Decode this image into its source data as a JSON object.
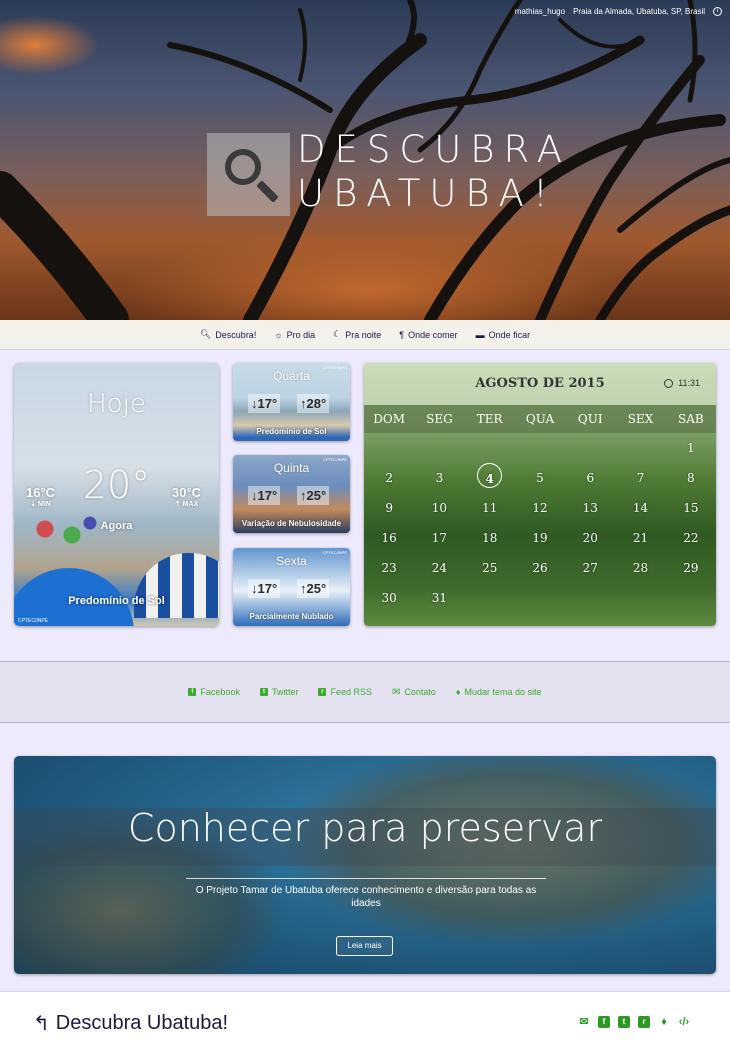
{
  "hero": {
    "credit_user": "mathias_hugo",
    "credit_location": "Praia da Almada, Ubatuba, SP, Brasil",
    "title_line1": "DESCUBRA",
    "title_line2": "UBATUBA!"
  },
  "nav": {
    "items": [
      {
        "icon": "search-icon",
        "label": "Descubra!"
      },
      {
        "icon": "sun-icon",
        "label": "Pro dia"
      },
      {
        "icon": "moon-icon",
        "label": "Pra noite"
      },
      {
        "icon": "cutlery-icon",
        "label": "Onde comer"
      },
      {
        "icon": "bed-icon",
        "label": "Onde ficar"
      }
    ]
  },
  "weather": {
    "today": {
      "label": "Hoje",
      "temp": "20°",
      "min": "16°C",
      "min_label": "MIN",
      "max": "30°C",
      "max_label": "MAX",
      "now_label": "Agora",
      "condition": "Predomínio de Sol",
      "source": "CPTEC/INPE"
    },
    "forecast": [
      {
        "day": "Quarta",
        "low": "↓17°",
        "high": "↑28°",
        "desc": "Predomínio de Sol",
        "source": "CPTEC/INPE"
      },
      {
        "day": "Quinta",
        "low": "↓17°",
        "high": "↑25°",
        "desc": "Variação de Nebulosidade",
        "source": "CPTEC/INPE"
      },
      {
        "day": "Sexta",
        "low": "↓17°",
        "high": "↑25°",
        "desc": "Parcialmente Nublado",
        "source": "CPTEC/INPE"
      }
    ]
  },
  "calendar": {
    "month": "AGOSTO DE 2015",
    "time": "11:31",
    "weekdays": [
      "DOM",
      "SEG",
      "TER",
      "QUA",
      "QUI",
      "SEX",
      "SAB"
    ],
    "weeks": [
      [
        "",
        "",
        "",
        "",
        "",
        "",
        "1"
      ],
      [
        "2",
        "3",
        "4",
        "5",
        "6",
        "7",
        "8"
      ],
      [
        "9",
        "10",
        "11",
        "12",
        "13",
        "14",
        "15"
      ],
      [
        "16",
        "17",
        "18",
        "19",
        "20",
        "21",
        "22"
      ],
      [
        "23",
        "24",
        "25",
        "26",
        "27",
        "28",
        "29"
      ],
      [
        "30",
        "31",
        "",
        "",
        "",
        "",
        ""
      ]
    ],
    "today": "4"
  },
  "social": {
    "links": [
      {
        "icon": "facebook-icon",
        "glyph": "f",
        "label": "Facebook"
      },
      {
        "icon": "twitter-icon",
        "glyph": "t",
        "label": "Twitter"
      },
      {
        "icon": "rss-icon",
        "glyph": "r",
        "label": "Feed RSS"
      },
      {
        "icon": "envelope-icon",
        "glyph": "✉",
        "label": "Contato"
      },
      {
        "icon": "lightbulb-icon",
        "glyph": "♦",
        "label": "Mudar tema do site"
      }
    ]
  },
  "banner": {
    "heading": "Conhecer para preservar",
    "text": "O Projeto Tamar de Ubatuba oferece conhecimento e diversão para todas as idades",
    "button": "Leia mais"
  },
  "footer": {
    "brand": "Descubra Ubatuba!",
    "icons": [
      "envelope-icon",
      "facebook-icon",
      "twitter-icon",
      "rss-icon",
      "lightbulb-icon",
      "code-icon"
    ]
  },
  "colors": {
    "accent_green": "#3caa2c",
    "nav_text": "#1b1b4a",
    "page_bg": "#eceafc"
  }
}
